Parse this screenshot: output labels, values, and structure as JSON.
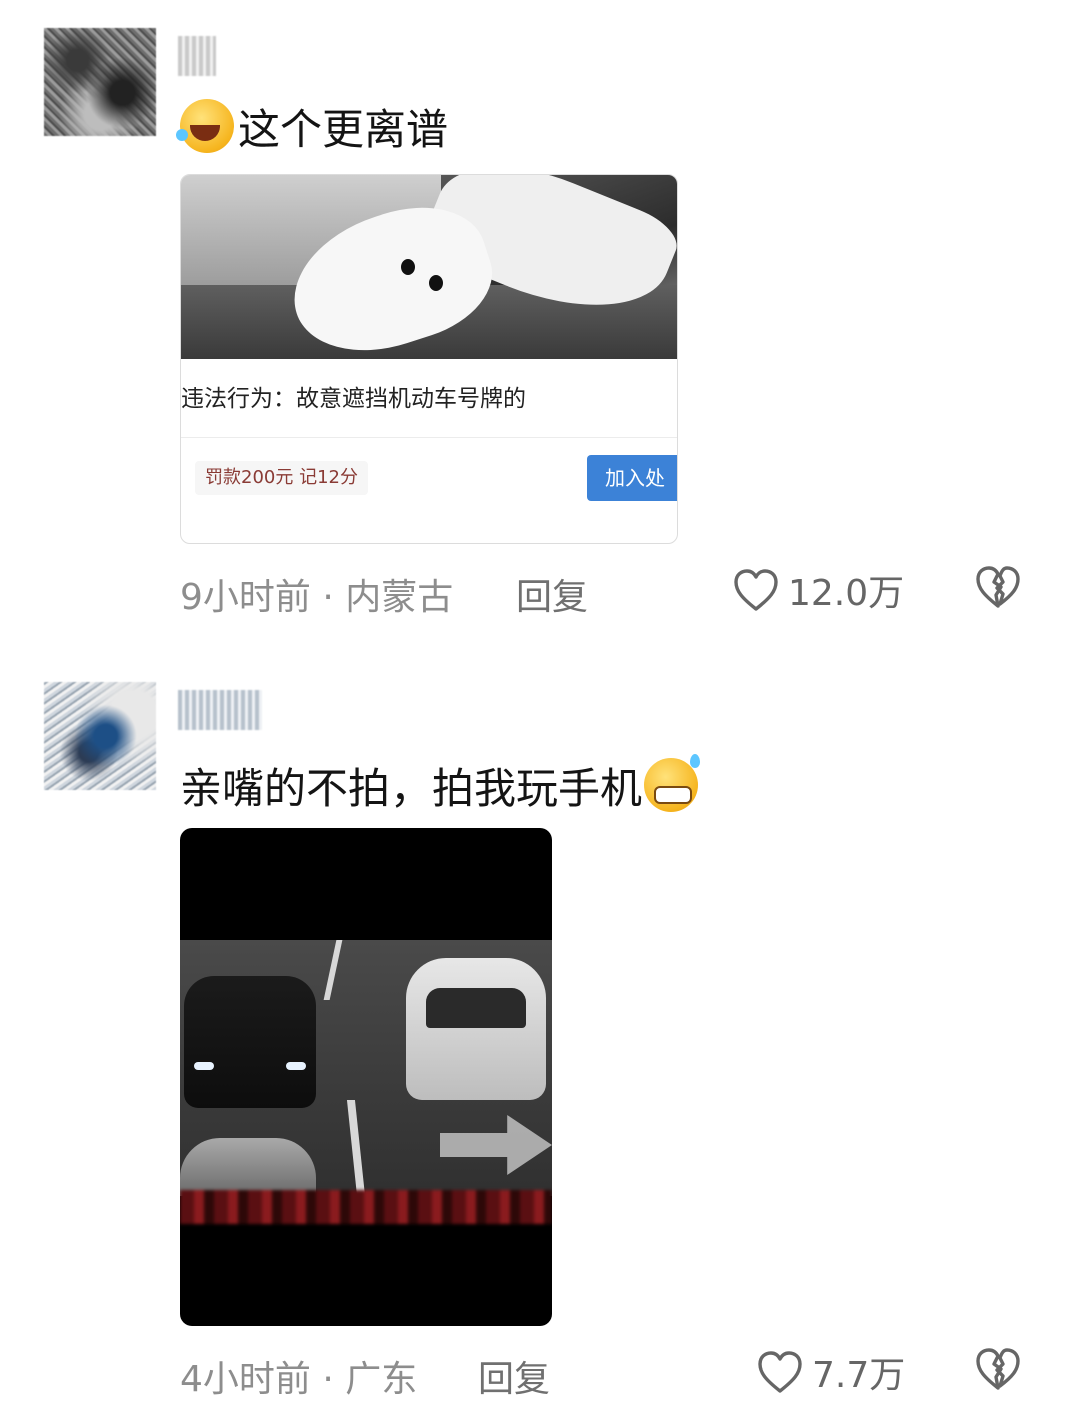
{
  "comments": [
    {
      "text": "这个更离谱",
      "card": {
        "title": "违法行为：故意遮挡机动车号牌的",
        "fine": "罚款200元 记12分",
        "button": "加入处"
      },
      "time_location": "9小时前 · 内蒙古",
      "reply_label": "回复",
      "likes": "12.0万"
    },
    {
      "text": "亲嘴的不拍，拍我玩手机",
      "time_location": "4小时前 · 广东",
      "reply_label": "回复",
      "likes": "7.7万"
    }
  ],
  "icons": {
    "like": "heart-outline-icon",
    "dislike": "broken-heart-icon",
    "emoji_1": "laughing-crying-emoji",
    "emoji_2": "grimacing-sweat-emoji"
  },
  "colors": {
    "text": "#141414",
    "meta": "#8d8d8d",
    "button": "#3c82d7",
    "fine": "#8a3b35"
  }
}
